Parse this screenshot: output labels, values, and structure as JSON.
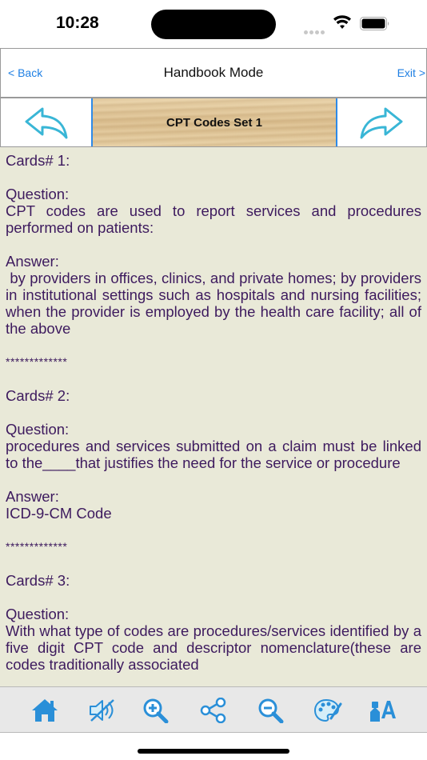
{
  "status_bar": {
    "time": "10:28"
  },
  "nav": {
    "back_label": "< Back",
    "title": "Handbook Mode",
    "exit_label": "Exit >"
  },
  "set_selector": {
    "title": "CPT Codes Set 1"
  },
  "colors": {
    "accent": "#2d8ae8",
    "text": "#3d1a5e",
    "content_bg": "#e9e9d8"
  },
  "cards": [
    {
      "header": "Cards# 1:",
      "question_label": "Question:",
      "question": "CPT codes are used to report services and procedures performed on patients:",
      "answer_label": "Answer:",
      "answer": " by providers in offices, clinics, and private homes; by providers in institutional settings such as hospitals and nursing facilities; when the provider is employed by the health care facility; all of the above",
      "separator": "*************"
    },
    {
      "header": "Cards# 2:",
      "question_label": "Question:",
      "question": "procedures and services submitted on a claim must be linked to the____that justifies the need for the service or procedure",
      "answer_label": "Answer:",
      "answer": "ICD-9-CM Code",
      "separator": "*************"
    },
    {
      "header": "Cards# 3:",
      "question_label": "Question:",
      "question": "With what type of codes are procedures/services identified by a five digit CPT code and descriptor nomenclature(these are codes traditionally associated"
    }
  ],
  "toolbar": {
    "icons": [
      "home-icon",
      "speaker-mute-icon",
      "zoom-in-icon",
      "share-icon",
      "zoom-out-icon",
      "palette-icon",
      "font-style-icon"
    ]
  }
}
